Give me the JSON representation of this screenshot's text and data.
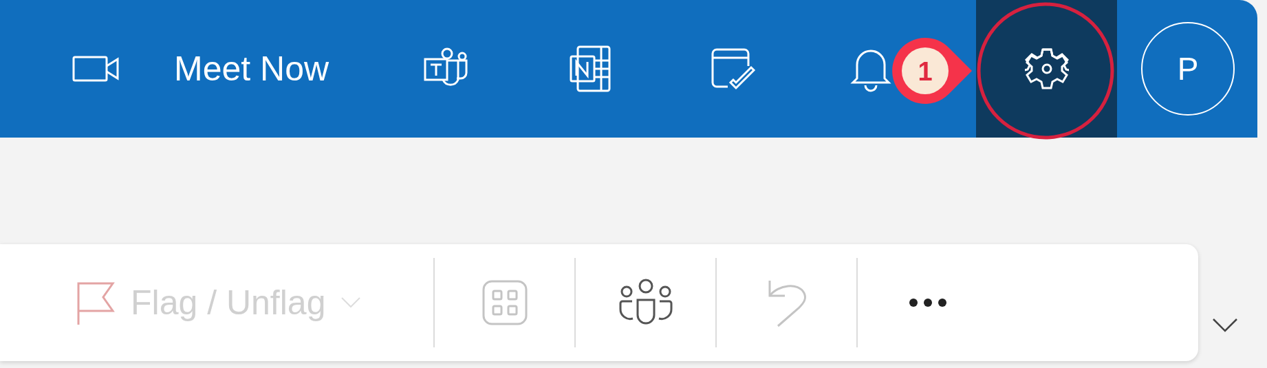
{
  "header": {
    "meet_now": {
      "label": "Meet Now"
    },
    "apps": [
      {
        "kind": "teams"
      },
      {
        "kind": "notes"
      },
      {
        "kind": "tasks"
      },
      {
        "kind": "bell"
      }
    ],
    "settings": {
      "selected": true
    },
    "avatar": {
      "initial": "P"
    }
  },
  "annotation": {
    "number": "1"
  },
  "toolbar": {
    "items": [
      {
        "kind": "flag",
        "label": "Flag / Unflag",
        "disabled": true
      },
      {
        "kind": "grid",
        "disabled": true
      },
      {
        "kind": "people",
        "disabled": false
      },
      {
        "kind": "undo",
        "disabled": true
      },
      {
        "kind": "more",
        "disabled": false
      }
    ]
  }
}
